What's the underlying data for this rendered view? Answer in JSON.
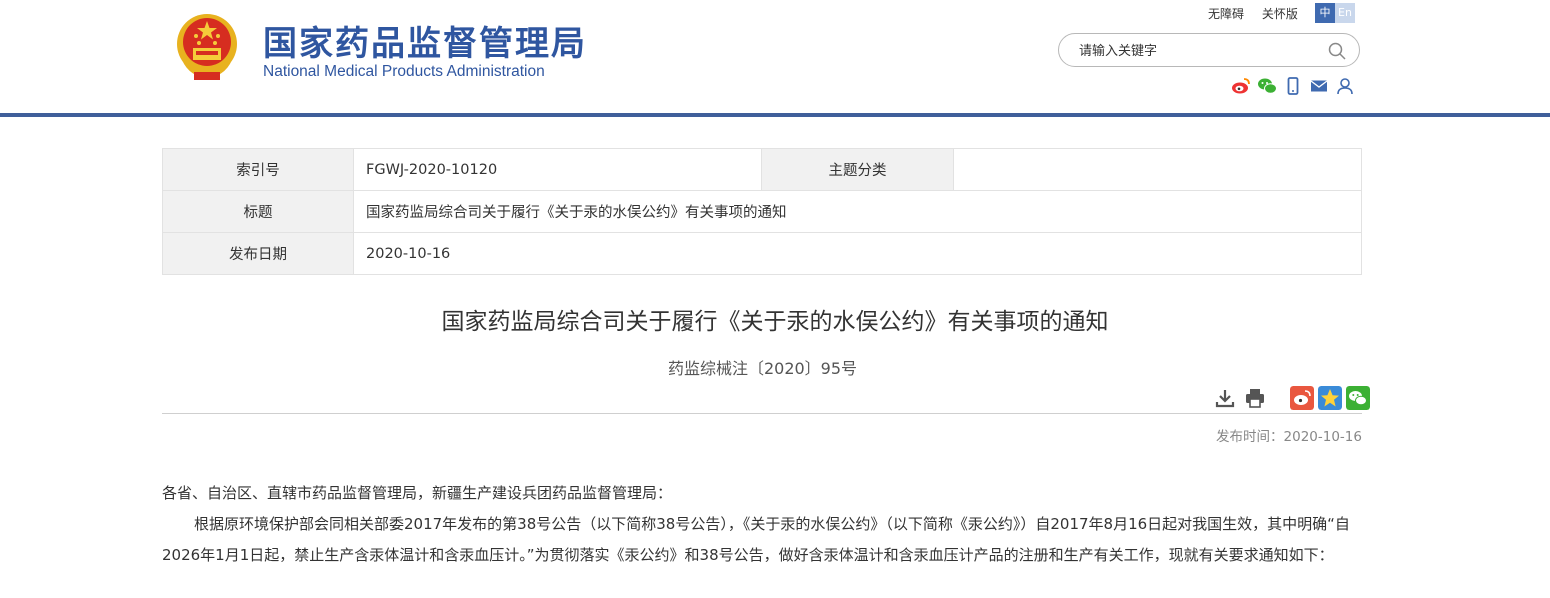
{
  "header": {
    "site_name_cn": "国家药品监督管理局",
    "site_name_en": "National Medical Products Administration",
    "links": {
      "accessibility": "无障碍",
      "care_mode": "关怀版"
    },
    "lang": {
      "zh": "中",
      "en": "En"
    },
    "search_placeholder": "请输入关键字",
    "social_icons": [
      "weibo-icon",
      "wechat-icon",
      "mobile-icon",
      "mail-icon",
      "user-icon"
    ],
    "accent_color": "#2f56a0"
  },
  "meta": {
    "index_label": "索引号",
    "index_value": "FGWJ-2020-10120",
    "category_label": "主题分类",
    "category_value": "",
    "title_label": "标题",
    "title_value": "国家药监局综合司关于履行《关于汞的水俣公约》有关事项的通知",
    "date_label": "发布日期",
    "date_value": "2020-10-16"
  },
  "article": {
    "title": "国家药监局综合司关于履行《关于汞的水俣公约》有关事项的通知",
    "doc_number": "药监综械注〔2020〕95号",
    "publish_time": "发布时间：2020-10-16",
    "salutation": "各省、自治区、直辖市药品监督管理局，新疆生产建设兵团药品监督管理局：",
    "paragraph1": "根据原环境保护部会同相关部委2017年发布的第38号公告（以下简称38号公告），《关于汞的水俣公约》（以下简称《汞公约》）自2017年8月16日起对我国生效，其中明确“自2026年1月1日起，禁止生产含汞体温计和含汞血压计。”为贯彻落实《汞公约》和38号公告，做好含汞体温计和含汞血压计产品的注册和生产有关工作，现就有关要求通知如下："
  }
}
